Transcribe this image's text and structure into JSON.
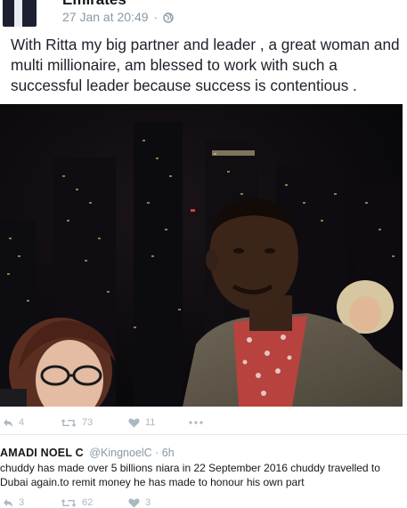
{
  "post": {
    "author": "Emirates",
    "timestamp": "27 Jan at 20:49",
    "separator": "·",
    "text": "With Ritta my big partner and leader , a great woman and multi millionaire, am blessed to work with such a successful leader because  success is contentious ."
  },
  "actions": {
    "reply_count": "4",
    "retweet_count": "73",
    "like_count": "11"
  },
  "reply": {
    "name": "AMADI NOEL C",
    "handle": "@KingnoelC · 6h",
    "text": "chuddy has made over 5 billions niara in 22 September 2016 chuddy travelled to Dubai again.to remit money he has made to honour his own part"
  },
  "reply_actions": {
    "reply_count": "3",
    "retweet_count": "62",
    "like_count": "3"
  },
  "colors": {
    "meta_gray": "#8899a6",
    "action_gray": "#aab8c2",
    "text": "#14171a"
  }
}
